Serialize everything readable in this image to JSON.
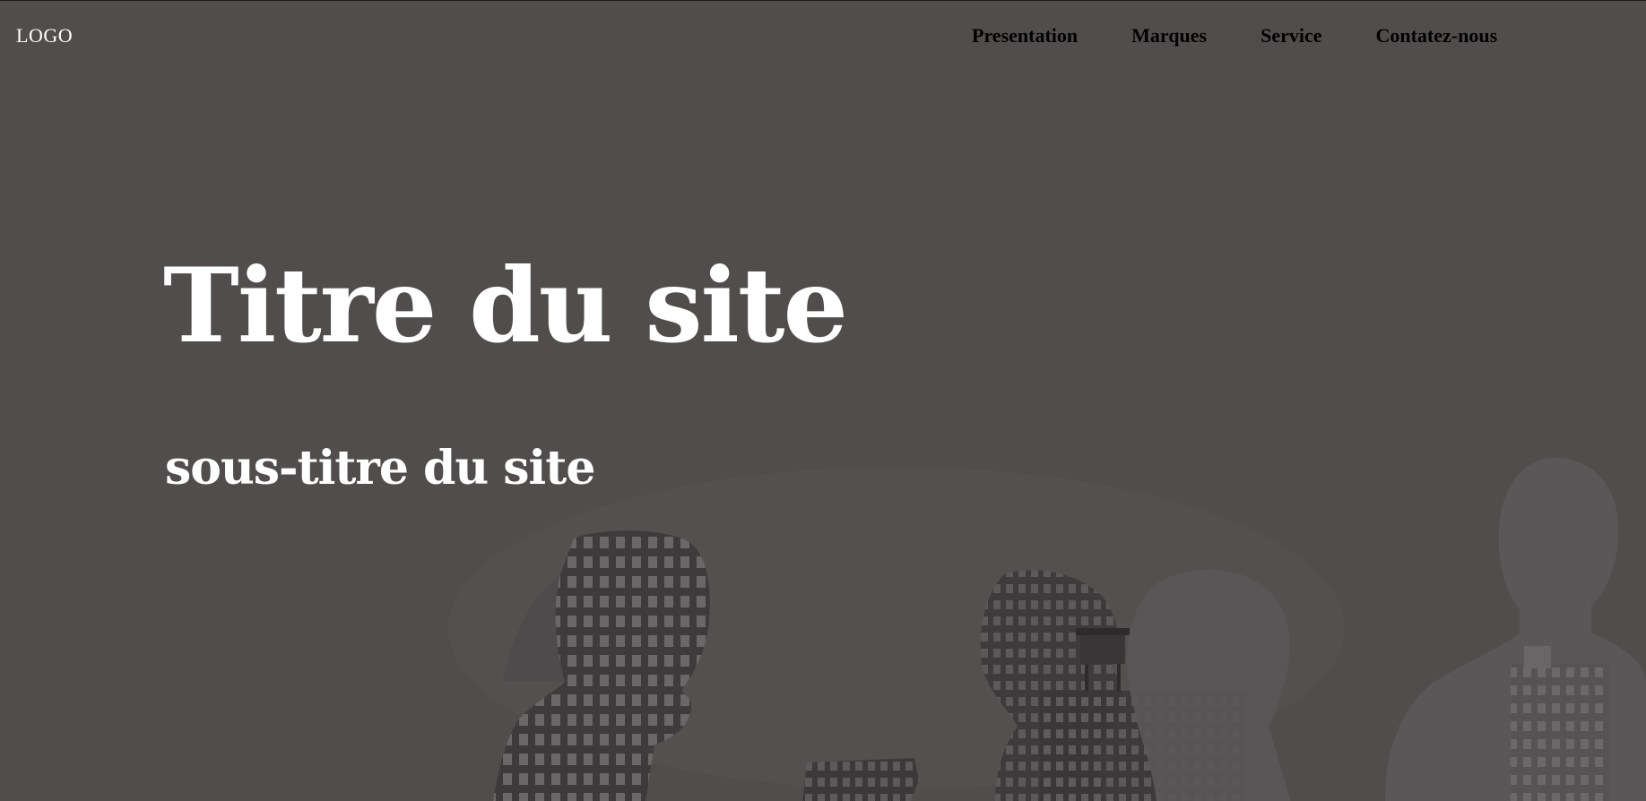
{
  "header": {
    "logo": "LOGO",
    "nav": [
      {
        "label": "Presentation"
      },
      {
        "label": "Marques"
      },
      {
        "label": "Service"
      },
      {
        "label": "Contatez-nous"
      }
    ]
  },
  "hero": {
    "title": "Titre du site",
    "subtitle": "sous-titre du site",
    "background_color": "#524d4d",
    "title_color": "#ffffff",
    "nav_text_color": "#000000",
    "background_image": "silhouettes-with-city-buildings"
  }
}
